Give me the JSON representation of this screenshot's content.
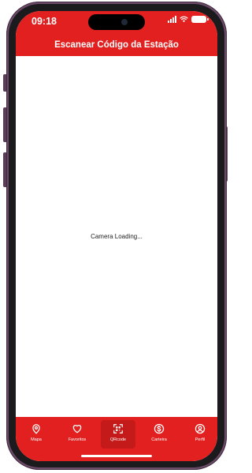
{
  "status_bar": {
    "time": "09:18"
  },
  "header": {
    "title": "Escanear Código da Estação"
  },
  "camera": {
    "loading_text": "Camera Loading..."
  },
  "tabs": [
    {
      "label": "Mapa",
      "icon": "map-pin-icon"
    },
    {
      "label": "Favoritos",
      "icon": "heart-icon"
    },
    {
      "label": "QRcode",
      "icon": "qrcode-icon",
      "active": true
    },
    {
      "label": "Carteira",
      "icon": "dollar-coin-icon"
    },
    {
      "label": "Perfil",
      "icon": "user-icon"
    }
  ],
  "colors": {
    "brand_red": "#e2201f",
    "active_tab": "#c41a1a",
    "frame": "#6f4b6b"
  }
}
